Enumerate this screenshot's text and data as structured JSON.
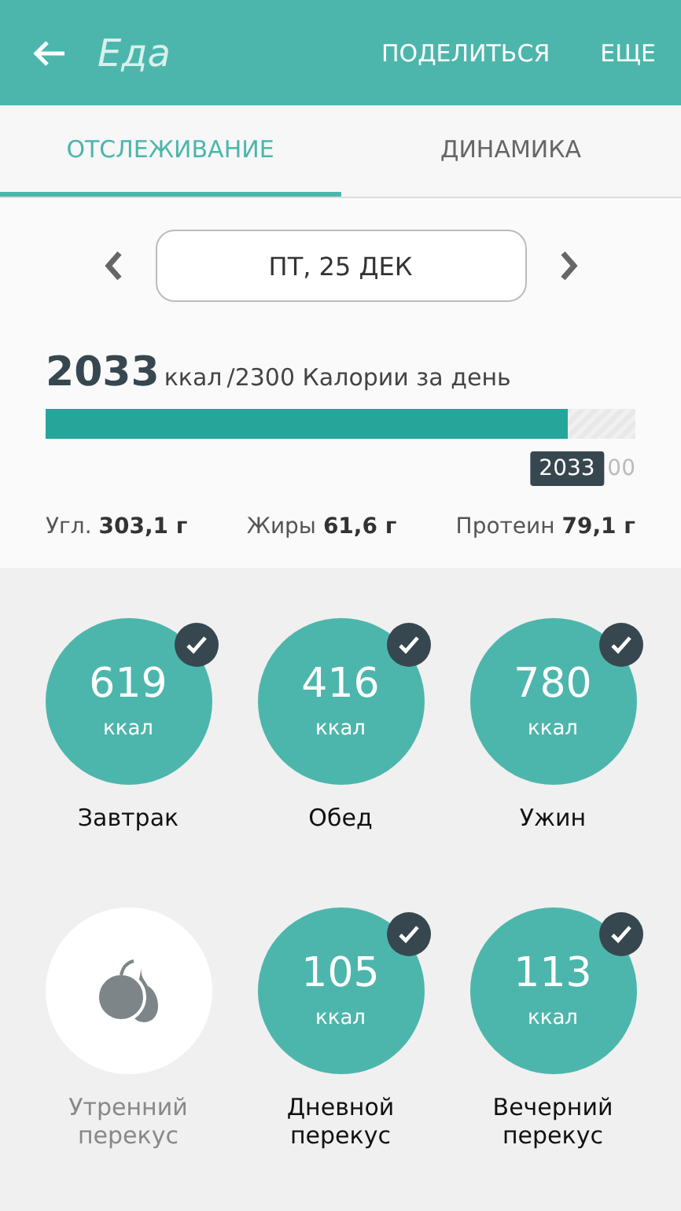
{
  "app_bar": {
    "title": "Еда",
    "actions": [
      "ПОДЕЛИТЬСЯ",
      "ЕЩЕ"
    ]
  },
  "tabs": [
    {
      "label": "ОТСЛЕЖИВАНИЕ",
      "selected": true
    },
    {
      "label": "ДИНАМИКА",
      "selected": false
    }
  ],
  "date": "ПТ, 25 ДЕК",
  "summary": {
    "consumed": "2033",
    "unit": "ккал",
    "goal_text": "/2300 Калории за день",
    "level": 0.884,
    "marker": "2033",
    "goal_label_partial": "00"
  },
  "macros": [
    {
      "label": "Угл.",
      "value": "303,1 г"
    },
    {
      "label": "Жиры",
      "value": "61,6 г"
    },
    {
      "label": "Протеин",
      "value": "79,1 г"
    }
  ],
  "meals": [
    {
      "name": "Завтрак",
      "calories": "619",
      "unit": "ккал",
      "logged": true
    },
    {
      "name": "Обед",
      "calories": "416",
      "unit": "ккал",
      "logged": true
    },
    {
      "name": "Ужин",
      "calories": "780",
      "unit": "ккал",
      "logged": true
    },
    {
      "name": "Утренний перекус",
      "logged": false
    },
    {
      "name": "Дневной перекус",
      "calories": "105",
      "unit": "ккал",
      "logged": true
    },
    {
      "name": "Вечерний перекус",
      "calories": "113",
      "unit": "ккал",
      "logged": true
    }
  ]
}
